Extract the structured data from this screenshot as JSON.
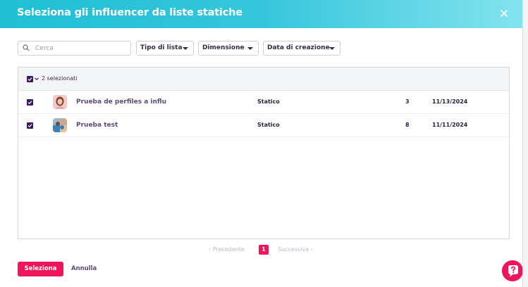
{
  "dialog": {
    "title": "Seleziona gli influencer da liste statiche",
    "close_icon": "close-icon"
  },
  "filters": {
    "search_placeholder": "Cerca",
    "search_value": "",
    "list_type_label": "Tipo di lista",
    "size_label": "Dimensione",
    "created_date_label": "Data di creazione"
  },
  "table": {
    "selected_count_label": "2 selezionati",
    "rows": [
      {
        "selected": true,
        "name": "Prueba de perfiles a influ",
        "type": "Statico",
        "count": "3",
        "date": "11/13/2024"
      },
      {
        "selected": true,
        "name": "Prueba test",
        "type": "Statico",
        "count": "8",
        "date": "11/11/2024"
      }
    ]
  },
  "pagination": {
    "prev_label": "‹ Precedente",
    "current_page": "1",
    "next_label": "Successiva ›"
  },
  "actions": {
    "select_label": "Seleziona",
    "cancel_label": "Annulla"
  },
  "colors": {
    "header_gradient_start": "#1fbfd6",
    "header_gradient_end": "#83e3ee",
    "accent": "#f0145a",
    "checkbox": "#3b1a5c"
  }
}
